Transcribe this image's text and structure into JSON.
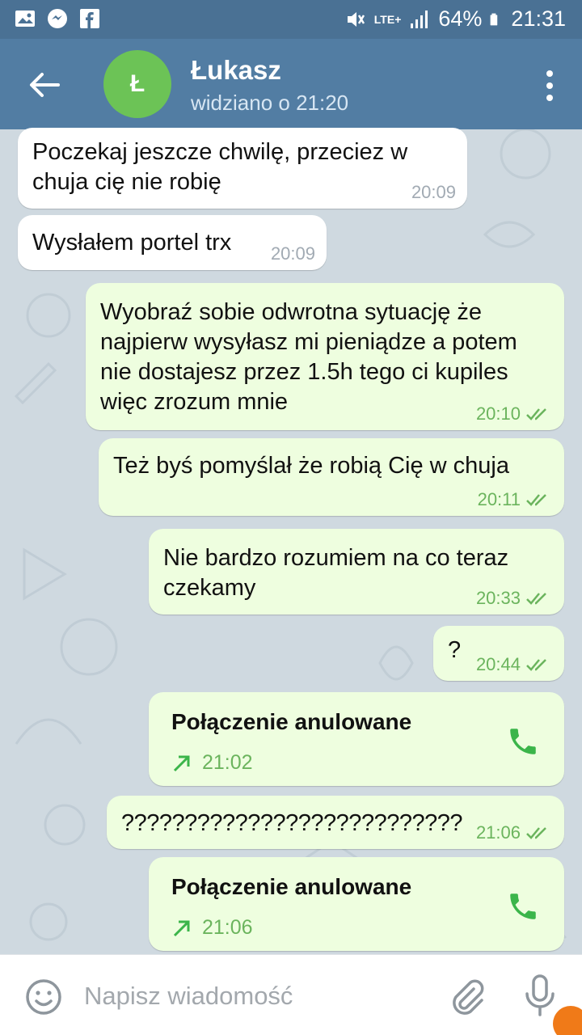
{
  "status_bar": {
    "battery": "64%",
    "time": "21:31",
    "network": "LTE+",
    "icons": [
      "gallery-icon",
      "messenger-icon",
      "facebook-icon",
      "mute-icon",
      "signal-icon",
      "battery-icon"
    ]
  },
  "header": {
    "avatar_letter": "Ł",
    "name": "Łukasz",
    "status": "widziano o 21:20",
    "colors": {
      "header": "#527da3",
      "avatar": "#6cc356"
    }
  },
  "messages": [
    {
      "dir": "in",
      "text": "Poczekaj jeszcze chwilę, przeciez w chuja cię nie robię",
      "time": "20:09"
    },
    {
      "dir": "in",
      "text": "Wysłałem portel trx",
      "time": "20:09"
    },
    {
      "dir": "out",
      "text": "Wyobraź sobie odwrotna sytuację że najpierw wysyłasz mi pieniądze a potem nie dostajesz przez 1.5h tego ci kupiles więc zrozum mnie",
      "time": "20:10",
      "read": true
    },
    {
      "dir": "out",
      "text": "Też byś pomyślał że robią Cię w chuja",
      "time": "20:11",
      "read": true
    },
    {
      "dir": "out",
      "text": "Nie bardzo rozumiem na co teraz czekamy",
      "time": "20:33",
      "read": true
    },
    {
      "dir": "out",
      "text": "?",
      "time": "20:44",
      "read": true
    },
    {
      "dir": "out",
      "type": "call",
      "title": "Połączenie anulowane",
      "time": "21:02"
    },
    {
      "dir": "out",
      "text": "???????????????????????????",
      "time": "21:06",
      "read": true
    },
    {
      "dir": "out",
      "type": "call",
      "title": "Połączenie anulowane",
      "time": "21:06"
    }
  ],
  "input": {
    "placeholder": "Napisz wiadomość"
  },
  "colors": {
    "out_bubble": "#eefedf",
    "in_bubble": "#ffffff",
    "accent_green": "#6bb45d",
    "call_arrow": "#3bb54a"
  }
}
